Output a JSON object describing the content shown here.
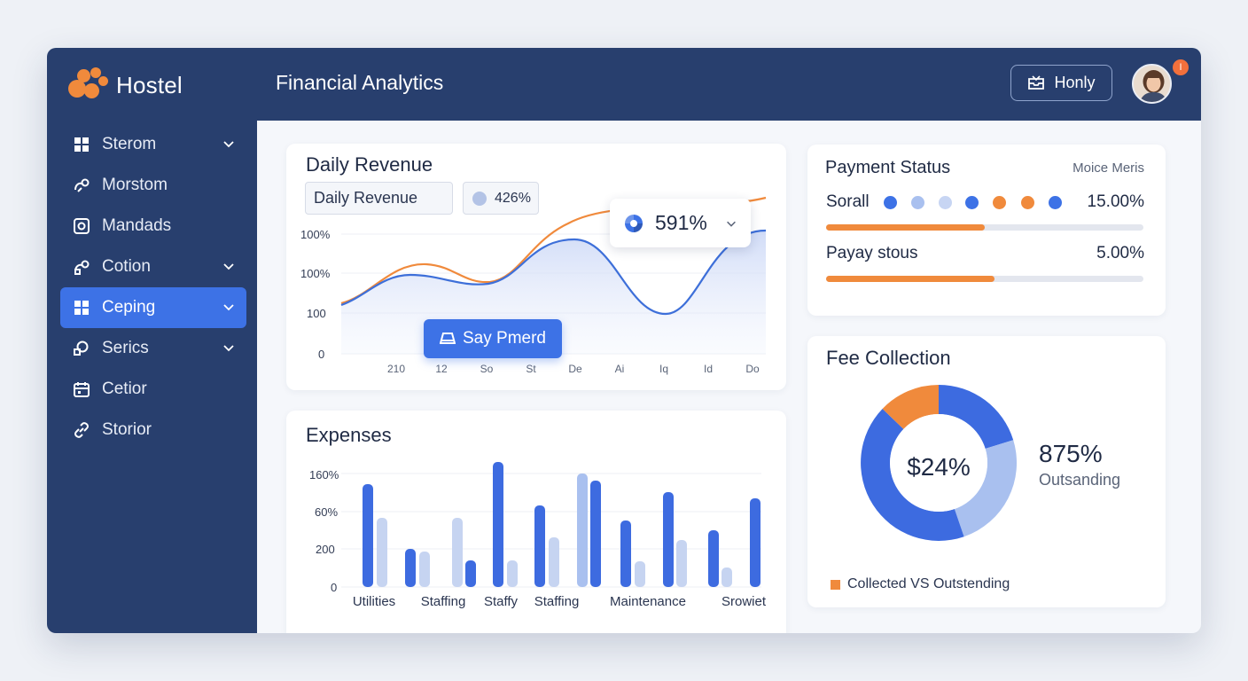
{
  "brand": {
    "name": "Hostel",
    "color": "#f08a3c"
  },
  "header": {
    "title": "Financial Analytics",
    "button_label": "Honly",
    "notification_count": "I"
  },
  "sidebar": {
    "items": [
      {
        "label": "Sterom",
        "icon": "grid-icon",
        "chevron": true,
        "active": false
      },
      {
        "label": "Morstom",
        "icon": "link-icon",
        "chevron": false,
        "active": false
      },
      {
        "label": "Mandads",
        "icon": "square-icon",
        "chevron": false,
        "active": false
      },
      {
        "label": "Cotion",
        "icon": "link-icon",
        "chevron": true,
        "active": false
      },
      {
        "label": "Ceping",
        "icon": "grid-icon",
        "chevron": true,
        "active": true
      },
      {
        "label": "Serics",
        "icon": "tag-icon",
        "chevron": true,
        "active": false
      },
      {
        "label": "Cetior",
        "icon": "calendar-icon",
        "chevron": false,
        "active": false
      },
      {
        "label": "Storior",
        "icon": "chain-icon",
        "chevron": false,
        "active": false
      }
    ]
  },
  "revenue": {
    "title": "Daily Revenue",
    "select_value": "Daily Revenue",
    "badge_value": "426%",
    "float_value": "591%",
    "action_button": "Say Pmerd",
    "y_ticks": [
      "100%",
      "100%",
      "100",
      "0"
    ],
    "x_ticks": [
      "210",
      "12",
      "So",
      "St",
      "De",
      "Ai",
      "Iq",
      "Id",
      "Do"
    ]
  },
  "expenses": {
    "title": "Expenses",
    "y_ticks": [
      "160%",
      "60%",
      "200",
      "0"
    ],
    "x_labels": [
      "Utilities",
      "Staffing",
      "Staffy",
      "Staffing",
      "Maintenance",
      "Srowiet"
    ]
  },
  "payment": {
    "title": "Payment Status",
    "link": "Moice Meris",
    "rows": [
      {
        "label": "Sorall",
        "pct": "15.00%",
        "fill": 0.5
      },
      {
        "label": "Payay stous",
        "pct": "5.00%",
        "fill": 0.53
      }
    ],
    "dot_colors": [
      "#3d72e6",
      "#a9c0ef",
      "#c7d5f3",
      "#3d72e6",
      "#f08a3c",
      "#f08a3c",
      "#3d72e6"
    ]
  },
  "fee": {
    "title": "Fee Collection",
    "center_value": "$24%",
    "side_value": "875%",
    "side_label": "Outsanding",
    "legend": "Collected VS Outstending"
  },
  "colors": {
    "accent": "#3d72e6",
    "orange": "#f08a3c",
    "navy": "#283f6e",
    "light_blue": "#a9c0ef"
  }
}
